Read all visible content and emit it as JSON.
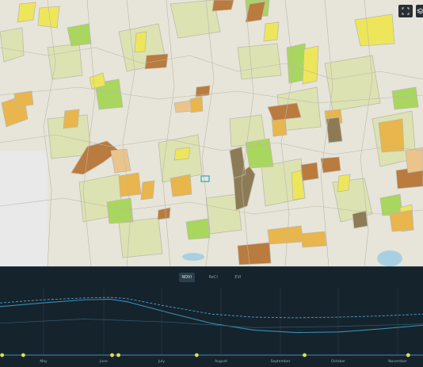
{
  "map": {
    "controls": [
      {
        "name": "fullscreen-icon"
      },
      {
        "name": "layers-icon"
      }
    ],
    "colors": {
      "background": "#e8e6dc",
      "road": "#bcb8ae",
      "field_light": "#dfe3b0",
      "field_green": "#a8d65c",
      "field_yellow": "#eee85a",
      "field_orange": "#e8b44a",
      "field_brown": "#b87a3e",
      "field_dark": "#8f7a52",
      "water": "#a9cfe0",
      "selection": "#2aa8c2"
    }
  },
  "panel": {
    "tabs": [
      {
        "label": "NDVI",
        "active": true
      },
      {
        "label": "ReCI",
        "active": false
      },
      {
        "label": "EVI",
        "active": false
      }
    ],
    "months": [
      "May",
      "June",
      "July",
      "August",
      "September",
      "October",
      "November"
    ]
  },
  "chart_data": {
    "type": "line",
    "title": "",
    "xlabel": "",
    "ylabel": "",
    "x_ticks": [
      "May",
      "June",
      "July",
      "August",
      "September",
      "October",
      "November"
    ],
    "series": [
      {
        "style": "dashed",
        "x": [
          0,
          0.1,
          0.2,
          0.26,
          0.3,
          0.4,
          0.5,
          0.6,
          0.7,
          0.8,
          0.9,
          1.0
        ],
        "y": [
          0.78,
          0.83,
          0.86,
          0.87,
          0.85,
          0.72,
          0.6,
          0.55,
          0.54,
          0.55,
          0.57,
          0.6
        ]
      },
      {
        "style": "solid",
        "x": [
          0,
          0.1,
          0.2,
          0.26,
          0.3,
          0.4,
          0.5,
          0.6,
          0.7,
          0.8,
          0.9,
          1.0
        ],
        "y": [
          0.72,
          0.78,
          0.83,
          0.84,
          0.8,
          0.62,
          0.45,
          0.34,
          0.3,
          0.31,
          0.36,
          0.42
        ]
      },
      {
        "style": "faint",
        "x": [
          0,
          0.2,
          0.4,
          0.6,
          0.8,
          1.0
        ],
        "y": [
          0.45,
          0.52,
          0.47,
          0.38,
          0.4,
          0.44
        ]
      }
    ],
    "observations": [
      0.005,
      0.055,
      0.265,
      0.28,
      0.465,
      0.72,
      0.965
    ]
  }
}
